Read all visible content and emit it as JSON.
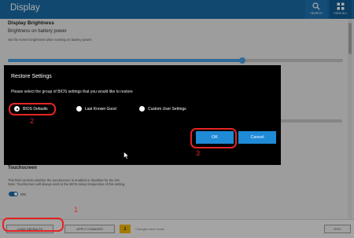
{
  "header": {
    "title": "Display",
    "search_label": "SEARCH",
    "view_all_label": "VIEW ALL",
    "bg_color": "#1a6aa6"
  },
  "page": {
    "section_title": "Display Brightness",
    "subsection_title": "Brightness on battery power",
    "description": "Set the screen brightness when running on battery power:",
    "brightness_level_percent": 70,
    "touchscreen": {
      "title": "Touchscreen",
      "description_line1": "This field controls whether the touchscreen is enabled or disabled for the OS.",
      "description_line2": "Note: Touchscreen will always work in the BIOS setup irrespective of this setting.",
      "toggle_state": "ON"
    }
  },
  "footer": {
    "load_defaults": "LOAD DEFAULTS",
    "apply_changes": "APPLY CHANGES",
    "pending_count": "2",
    "pending_text": "Changes were made",
    "exit": "EXIT"
  },
  "dialog": {
    "title": "Restore Settings",
    "prompt": "Please select the group of BIOS settings that you would like to restore",
    "options": [
      {
        "label": "BIOS Defaults",
        "checked": true
      },
      {
        "label": "Last Known Good",
        "checked": false
      },
      {
        "label": "Custom User Settings",
        "checked": false
      }
    ],
    "ok_label": "OK",
    "cancel_label": "Cancel",
    "button_color": "#1f8ad6"
  },
  "annotations": {
    "step1": "1",
    "step2": "2",
    "step3": "3",
    "color": "#e52424"
  },
  "icons": {
    "search": "search-icon",
    "view_all": "grid-icon",
    "cursor": "mouse-pointer-icon"
  }
}
